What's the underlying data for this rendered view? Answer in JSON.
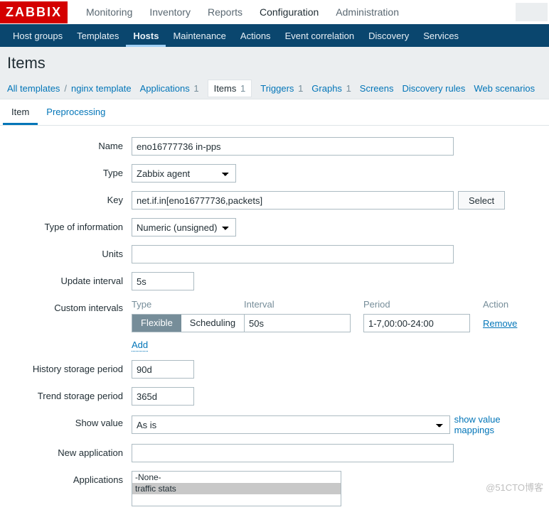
{
  "logo": "ZABBIX",
  "topnav": {
    "monitoring": "Monitoring",
    "inventory": "Inventory",
    "reports": "Reports",
    "configuration": "Configuration",
    "administration": "Administration"
  },
  "subnav": {
    "hostgroups": "Host groups",
    "templates": "Templates",
    "hosts": "Hosts",
    "maintenance": "Maintenance",
    "actions": "Actions",
    "eventcorr": "Event correlation",
    "discovery": "Discovery",
    "services": "Services"
  },
  "page_title": "Items",
  "breadcrumb": {
    "all_templates": "All templates",
    "sep": "/",
    "host": "nginx template",
    "applications": "Applications",
    "applications_n": "1",
    "items": "Items",
    "items_n": "1",
    "triggers": "Triggers",
    "triggers_n": "1",
    "graphs": "Graphs",
    "graphs_n": "1",
    "screens": "Screens",
    "discovery": "Discovery rules",
    "web": "Web scenarios"
  },
  "tabs": {
    "item": "Item",
    "preproc": "Preprocessing"
  },
  "labels": {
    "name": "Name",
    "type": "Type",
    "key": "Key",
    "type_info": "Type of information",
    "units": "Units",
    "update_interval": "Update interval",
    "custom_intervals": "Custom intervals",
    "history": "History storage period",
    "trend": "Trend storage period",
    "show_value": "Show value",
    "new_application": "New application",
    "applications": "Applications"
  },
  "values": {
    "name": "eno16777736 in-pps",
    "type": "Zabbix agent",
    "key": "net.if.in[eno16777736,packets]",
    "type_info": "Numeric (unsigned)",
    "units": "",
    "update_interval": "5s",
    "history": "90d",
    "trend": "365d",
    "show_value": "As is",
    "new_application": ""
  },
  "buttons": {
    "select": "Select",
    "show_value_mappings": "show value mappings",
    "add": "Add",
    "remove": "Remove"
  },
  "custom_intervals": {
    "head_type": "Type",
    "head_interval": "Interval",
    "head_period": "Period",
    "head_action": "Action",
    "flexible": "Flexible",
    "scheduling": "Scheduling",
    "interval": "50s",
    "period": "1-7,00:00-24:00"
  },
  "applications_list": {
    "none": "-None-",
    "opt1": "traffic stats"
  },
  "watermark": "@51CTO博客"
}
